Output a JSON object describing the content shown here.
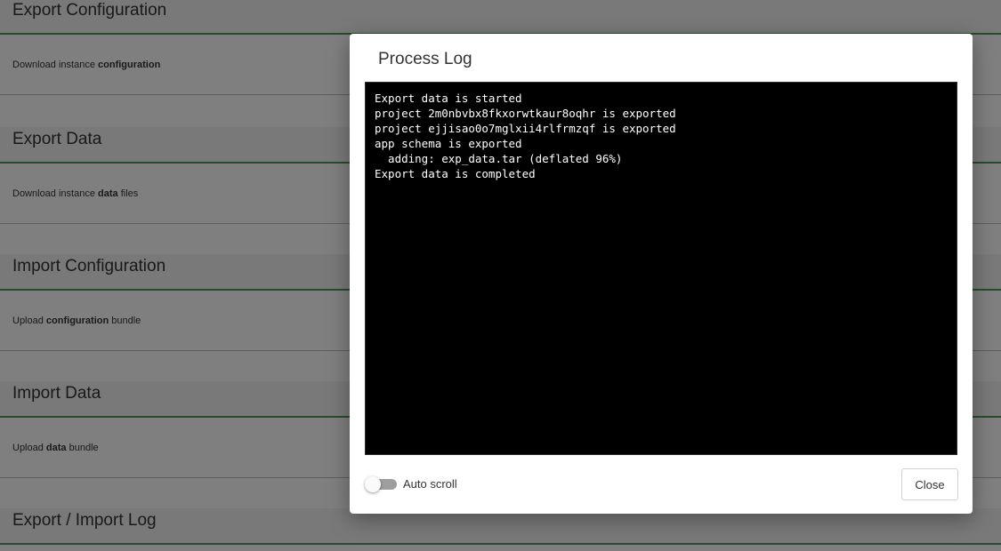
{
  "sections": [
    {
      "title": "Export Configuration",
      "desc_pre": "Download instance ",
      "desc_bold": "configuration",
      "desc_post": ""
    },
    {
      "title": "Export Data",
      "desc_pre": "Download instance ",
      "desc_bold": "data",
      "desc_post": " files"
    },
    {
      "title": "Import Configuration",
      "desc_pre": "Upload ",
      "desc_bold": "configuration",
      "desc_post": " bundle"
    },
    {
      "title": "Import Data",
      "desc_pre": "Upload ",
      "desc_bold": "data",
      "desc_post": " bundle"
    },
    {
      "title": "Export / Import Log",
      "desc_pre": "",
      "desc_bold": "",
      "desc_post": ""
    }
  ],
  "modal": {
    "title": "Process Log",
    "log_lines": [
      "Export data is started",
      "project 2m0nbvbx8fkxorwtkaur8oqhr is exported",
      "project ejjisao0o7mglxii4rlfrmzqf is exported",
      "app schema is exported",
      "  adding: exp_data.tar (deflated 96%)",
      "Export data is completed"
    ],
    "auto_scroll_label": "Auto scroll",
    "auto_scroll_on": false,
    "close_label": "Close"
  },
  "colors": {
    "section_accent": "#4c9a57",
    "overlay": "rgba(0,0,0,0.5)",
    "log_background": "#000000",
    "log_text": "#ffffff"
  }
}
